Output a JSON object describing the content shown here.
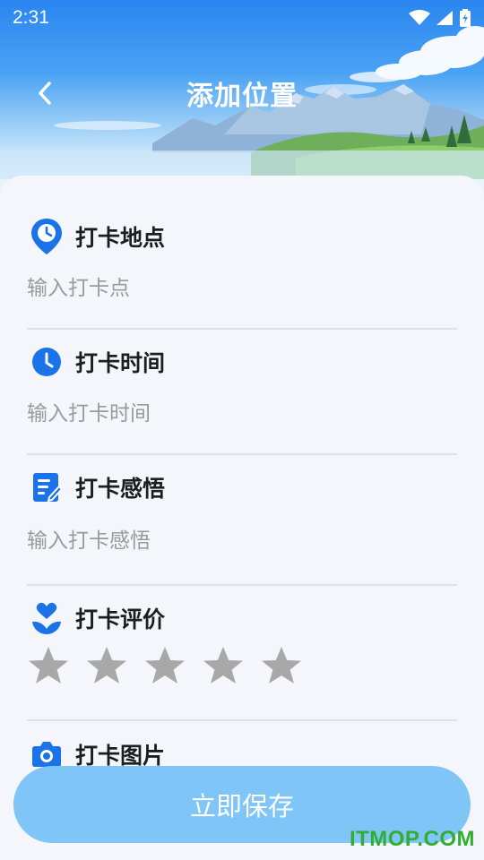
{
  "status_bar": {
    "time": "2:31"
  },
  "header": {
    "back_icon": "chevron-left-icon",
    "title": "添加位置"
  },
  "form": {
    "location": {
      "icon": "location-pin-icon",
      "label": "打卡地点",
      "placeholder": "输入打卡点",
      "value": ""
    },
    "time": {
      "icon": "clock-icon",
      "label": "打卡时间",
      "placeholder": "输入打卡时间",
      "value": ""
    },
    "feelings": {
      "icon": "edit-note-icon",
      "label": "打卡感悟",
      "placeholder": "输入打卡感悟",
      "value": ""
    },
    "rating": {
      "icon": "heart-flower-icon",
      "label": "打卡评价",
      "stars_total": 5,
      "stars_selected": 0
    },
    "photo": {
      "icon": "camera-icon",
      "label": "打卡图片"
    }
  },
  "save_button": {
    "label": "立即保存"
  },
  "watermark": "ITMOP.COM",
  "colors": {
    "accent_blue": "#1a73e8",
    "save_button_bg": "#7fc5f8",
    "star_gray": "#a8a8a8",
    "watermark_green": "#2fae2f"
  }
}
